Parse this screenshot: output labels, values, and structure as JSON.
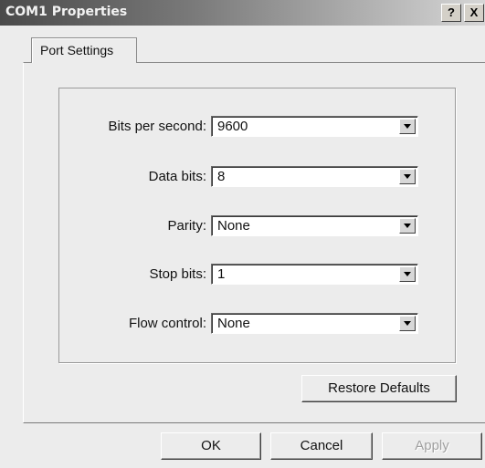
{
  "window": {
    "title": "COM1 Properties",
    "help_label": "?",
    "close_label": "X"
  },
  "tabs": [
    {
      "label": "Port Settings"
    }
  ],
  "settings": {
    "bits_per_second": {
      "label": "Bits per second:",
      "value": "9600"
    },
    "data_bits": {
      "label": "Data bits:",
      "value": "8"
    },
    "parity": {
      "label": "Parity:",
      "value": "None"
    },
    "stop_bits": {
      "label": "Stop bits:",
      "value": "1"
    },
    "flow_control": {
      "label": "Flow control:",
      "value": "None"
    }
  },
  "buttons": {
    "restore_defaults": "Restore Defaults",
    "ok": "OK",
    "cancel": "Cancel",
    "apply": "Apply"
  },
  "colors": {
    "title_bar_start": "#4a4a4a",
    "dialog_face": "#ececec"
  }
}
